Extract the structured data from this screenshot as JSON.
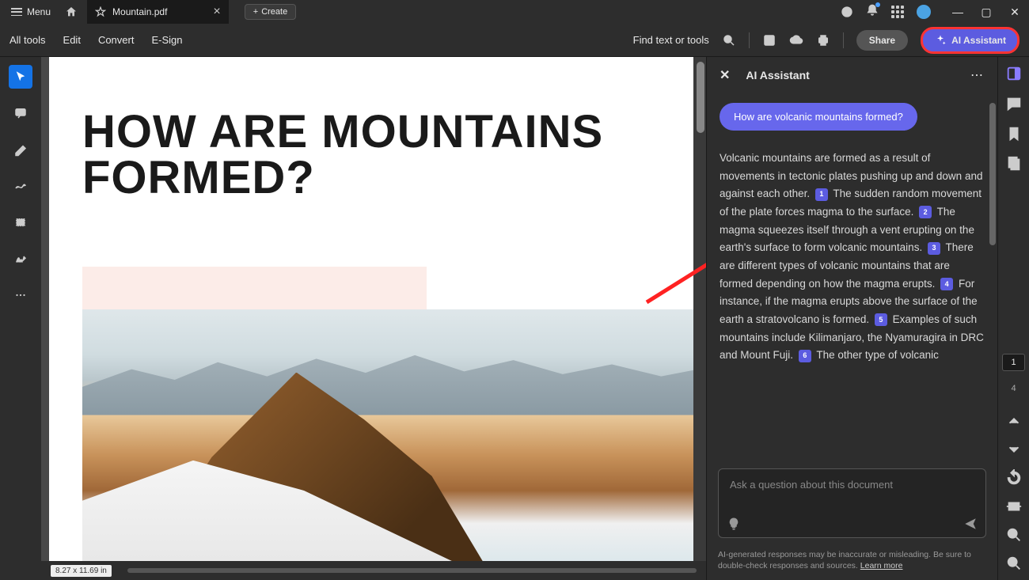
{
  "titlebar": {
    "menu": "Menu",
    "tab_title": "Mountain.pdf",
    "create": "Create"
  },
  "toolbar": {
    "all_tools": "All tools",
    "edit": "Edit",
    "convert": "Convert",
    "esign": "E-Sign",
    "find": "Find text or tools",
    "share": "Share",
    "ai_assistant": "AI Assistant"
  },
  "document": {
    "title": "HOW ARE MOUNTAINS FORMED?",
    "dimensions": "8.27 x 11.69 in"
  },
  "ai_panel": {
    "title": "AI Assistant",
    "question": "How are volcanic mountains formed?",
    "answer_p1": "Volcanic mountains are formed as a result of movements in tectonic plates pushing up and down and against each other.",
    "answer_p2": "The sudden random movement of the plate forces magma to the surface.",
    "answer_p3": "The magma squeezes itself through a vent erupting on the earth's surface to form volcanic mountains.",
    "answer_p4": "There are different types of volcanic mountains that are formed depending on how the magma erupts.",
    "answer_p5": "For instance, if the magma erupts above the surface of the earth a stratovolcano is formed.",
    "answer_p6": "Examples of such mountains include Kilimanjaro, the Nyamuragira in DRC and Mount Fuji.",
    "answer_p7": "The other type of volcanic",
    "cite1": "1",
    "cite2": "2",
    "cite3": "3",
    "cite4": "4",
    "cite5": "5",
    "cite6": "6",
    "placeholder": "Ask a question about this document",
    "disclaimer": "AI-generated responses may be inaccurate or misleading. Be sure to double-check responses and sources.",
    "learn_more": "Learn more"
  },
  "pages": {
    "current": "1",
    "total": "4"
  }
}
